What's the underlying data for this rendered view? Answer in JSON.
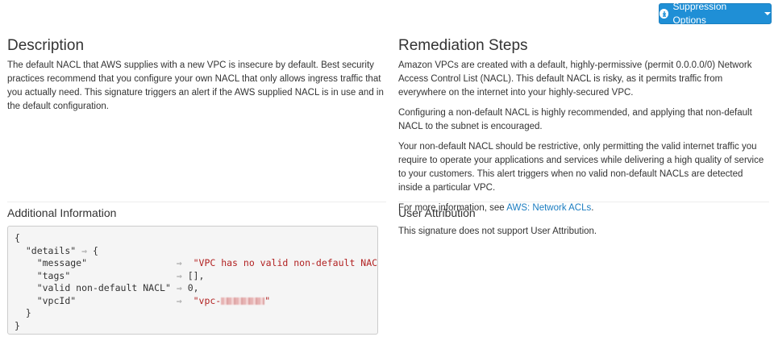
{
  "toolbar": {
    "suppression_label": "Suppression Options",
    "suppression_icon": "download-circle-icon"
  },
  "description": {
    "heading": "Description",
    "text": "The default NACL that AWS supplies with a new VPC is insecure by default. Best security practices recommend that you configure your own NACL that only allows ingress traffic that you actually need. This signature triggers an alert if the AWS supplied NACL is in use and in the default configuration."
  },
  "remediation": {
    "heading": "Remediation Steps",
    "paragraphs": [
      "Amazon VPCs are created with a default, highly-permissive (permit 0.0.0.0/0) Network Access Control List (NACL). This default NACL is risky, as it permits traffic from everywhere on the internet into your highly-secured VPC.",
      "Configuring a non-default NACL is highly recommended, and applying that non-default NACL to the subnet is encouraged.",
      "Your non-default NACL should be restrictive, only permitting the valid internet traffic you require to operate your applications and services while delivering a high quality of service to your customers. This alert triggers when no valid non-default NACLs are detected inside a particular VPC."
    ],
    "more_info_prefix": "For more information, see ",
    "more_info_link": "AWS: Network ACLs",
    "more_info_suffix": "."
  },
  "additional_info": {
    "heading": "Additional Information",
    "code": {
      "open": "{",
      "details_key": "\"details\"",
      "arrow": "⇒",
      "details_open": "{",
      "message_key": "\"message\"",
      "message_value": "\"VPC has no valid non-default NACLs\"",
      "tags_key": "\"tags\"",
      "tags_value": "[],",
      "valid_key": "\"valid non-default NACL\"",
      "valid_value": "0,",
      "vpcid_key": "\"vpcId\"",
      "vpcid_prefix": "\"vpc-",
      "vpcid_suffix": "\"",
      "details_close": "}",
      "close": "}"
    }
  },
  "user_attribution": {
    "heading": "User Attribution",
    "text": "This signature does not support User Attribution."
  }
}
